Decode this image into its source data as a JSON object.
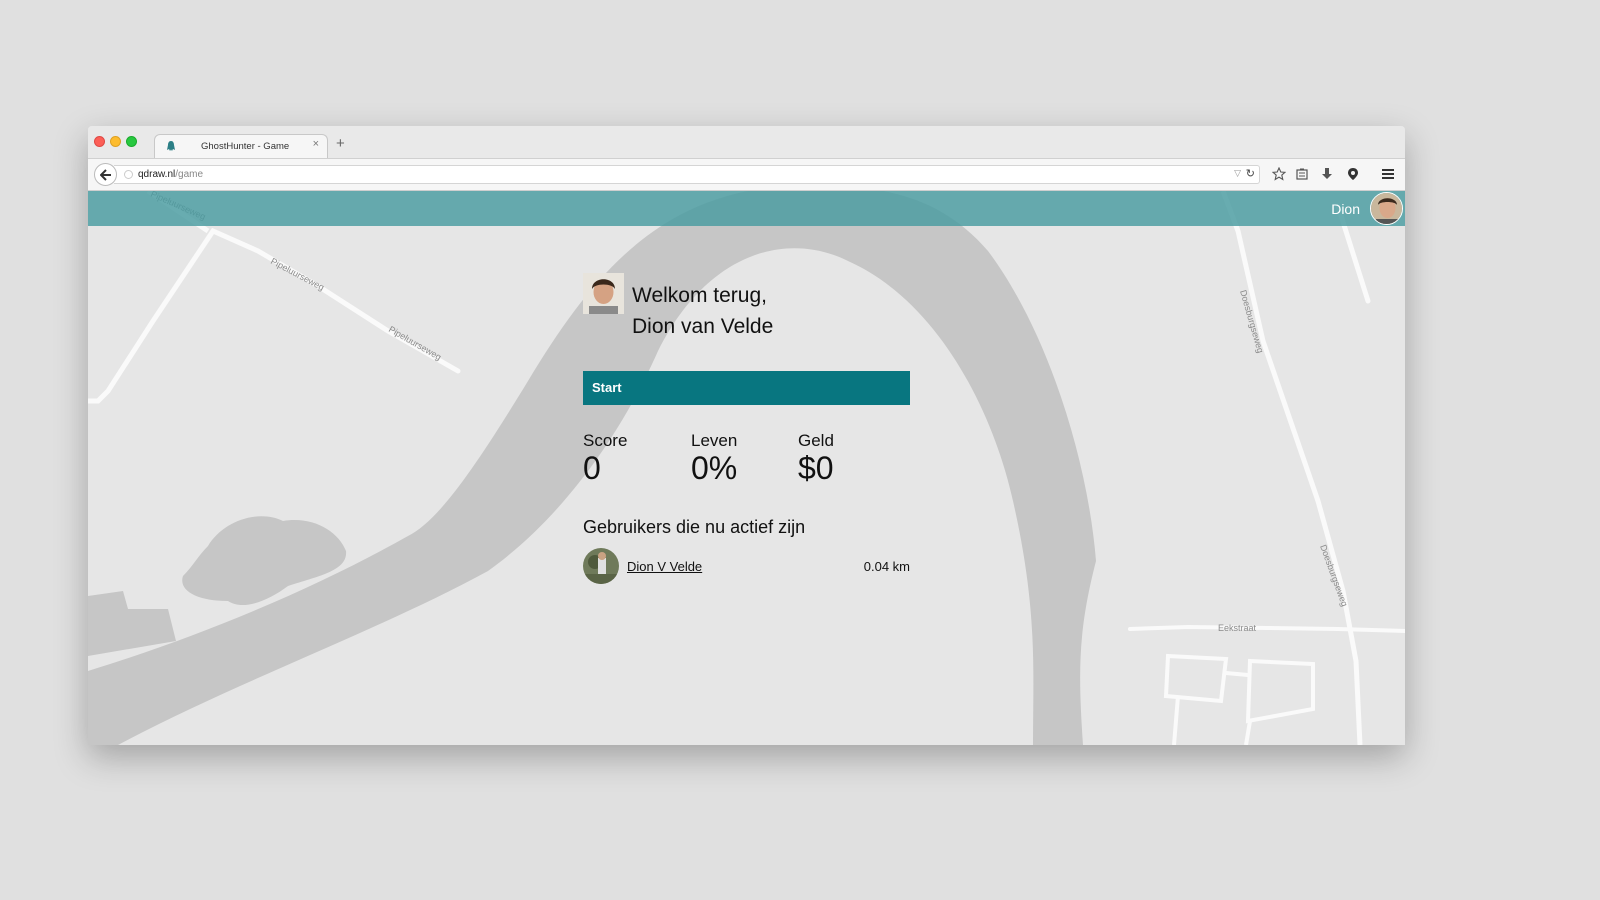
{
  "browser": {
    "tab_title": "GhostHunter - Game",
    "tab_close": "×",
    "new_tab": "+",
    "url_host": "qdraw.nl",
    "url_path": "/game"
  },
  "app": {
    "header_user_name": "Dion",
    "accent_color": "#087680",
    "header_color": "#5aa6ab"
  },
  "welcome": {
    "line1": "Welkom terug,",
    "line2": "Dion van Velde"
  },
  "start_button": "Start",
  "stats": [
    {
      "label": "Score",
      "value": "0"
    },
    {
      "label": "Leven",
      "value": "0%"
    },
    {
      "label": "Geld",
      "value": "$0"
    }
  ],
  "active_users": {
    "heading": "Gebruikers die nu actief zijn",
    "users": [
      {
        "name": "Dion V Velde",
        "distance": "0.04 km"
      }
    ]
  },
  "map": {
    "streets": [
      "Pipeluurseweg",
      "Pipeluurseweg",
      "Pipeluurseweg",
      "Doesburgseweg",
      "Doesburgseweg",
      "Eekstraat"
    ]
  }
}
